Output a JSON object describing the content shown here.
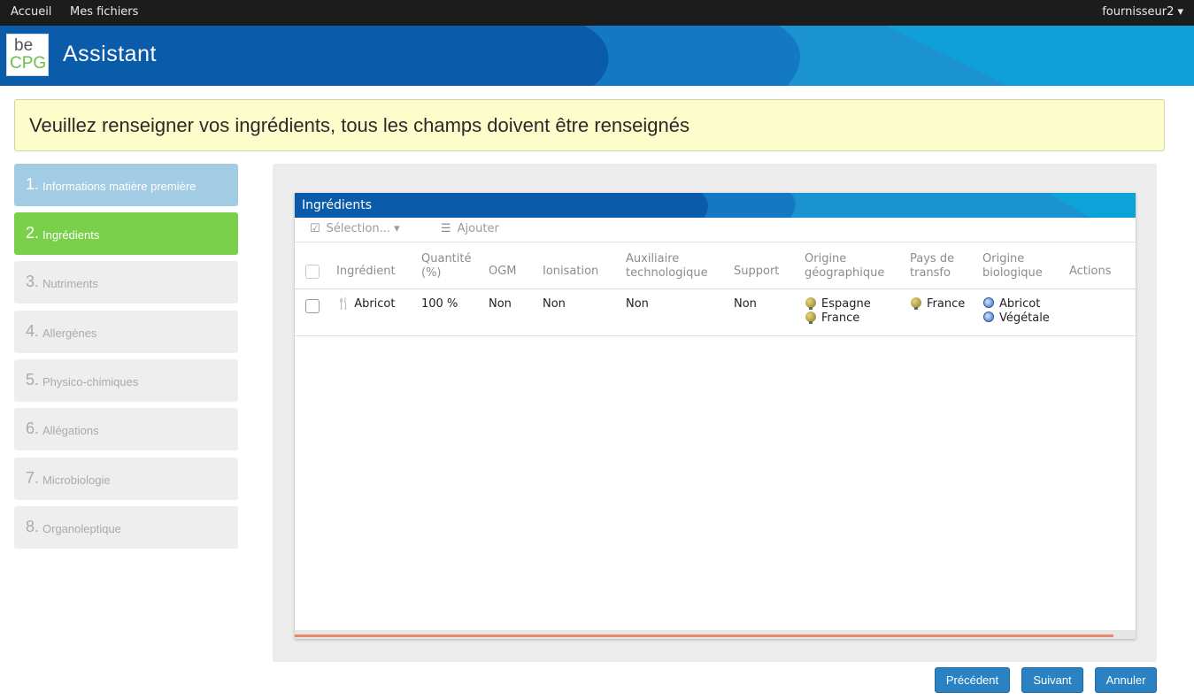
{
  "topbar": {
    "nav": [
      {
        "label": "Accueil"
      },
      {
        "label": "Mes fichiers"
      }
    ],
    "user": "fournisseur2 ▾"
  },
  "header": {
    "logo_top": "be",
    "logo_bottom": "CPG",
    "title": "Assistant"
  },
  "banner": {
    "message": "Veuillez renseigner vos ingrédients, tous les champs doivent être renseignés"
  },
  "steps": [
    {
      "num": "1.",
      "label": "Informations matière première",
      "state": "done"
    },
    {
      "num": "2.",
      "label": "Ingrédients",
      "state": "active"
    },
    {
      "num": "3.",
      "label": "Nutriments",
      "state": "todo"
    },
    {
      "num": "4.",
      "label": "Allergènes",
      "state": "todo"
    },
    {
      "num": "5.",
      "label": "Physico-chimiques",
      "state": "todo"
    },
    {
      "num": "6.",
      "label": "Allégations",
      "state": "todo"
    },
    {
      "num": "7.",
      "label": "Microbiologie",
      "state": "todo"
    },
    {
      "num": "8.",
      "label": "Organoleptique",
      "state": "todo"
    }
  ],
  "grid": {
    "title": "Ingrédients",
    "toolbar": {
      "selection": "Sélection... ▾",
      "add": "Ajouter"
    },
    "columns": [
      {
        "line1": "Ingrédient",
        "line2": ""
      },
      {
        "line1": "Quantité",
        "line2": "(%)"
      },
      {
        "line1": "OGM",
        "line2": ""
      },
      {
        "line1": "Ionisation",
        "line2": ""
      },
      {
        "line1": "Auxiliaire",
        "line2": "technologique"
      },
      {
        "line1": "Support",
        "line2": ""
      },
      {
        "line1": "Origine",
        "line2": "géographique"
      },
      {
        "line1": "Pays de",
        "line2": "transfo"
      },
      {
        "line1": "Origine",
        "line2": "biologique"
      },
      {
        "line1": "Actions",
        "line2": ""
      }
    ],
    "rows": [
      {
        "ingredient": "Abricot",
        "quantite": "100 %",
        "ogm": "Non",
        "ionisation": "Non",
        "auxiliaire": "Non",
        "support": "Non",
        "origine_geo": [
          "Espagne",
          "France"
        ],
        "pays_transfo": [
          "France"
        ],
        "origine_bio": [
          "Abricot",
          "Végétale"
        ]
      }
    ]
  },
  "buttons": {
    "previous": "Précédent",
    "next": "Suivant",
    "cancel": "Annuler"
  },
  "colors": {
    "topbar": "#1c1c1c",
    "header_blue": "#0a5cab",
    "banner_bg": "#fdfdcc",
    "step_done": "#a2cce3",
    "step_active": "#7ad04a",
    "step_todo": "#eeeeee",
    "button": "#2a82c2",
    "scroll_accent": "#e9876a"
  }
}
